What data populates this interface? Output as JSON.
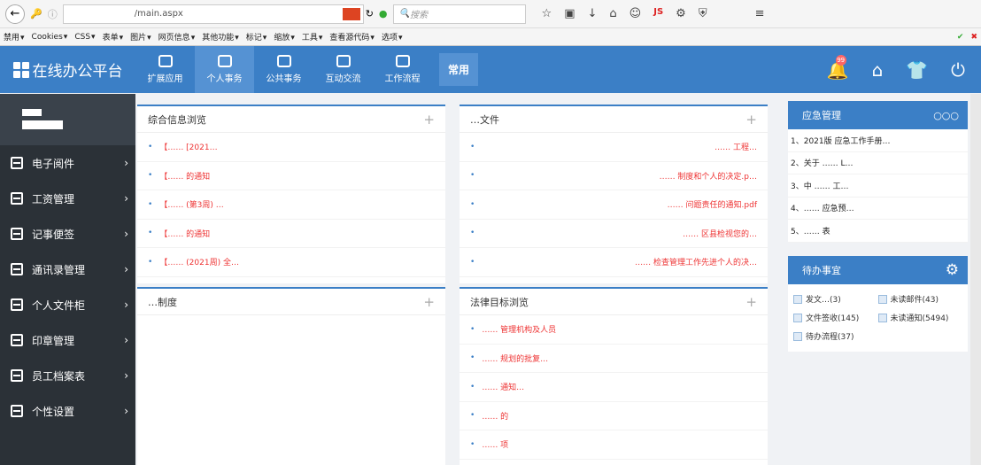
{
  "browser": {
    "url": "/main.aspx",
    "search_placeholder": "搜索",
    "bookmarks": [
      "禁用",
      "Cookies",
      "CSS",
      "表单",
      "图片",
      "网页信息",
      "其他功能",
      "标记",
      "缩放",
      "工具",
      "查看源代码",
      "选项"
    ]
  },
  "header": {
    "logo": "在线办公平台",
    "nav": [
      "扩展应用",
      "个人事务",
      "公共事务",
      "互动交流",
      "工作流程"
    ],
    "common": "常用",
    "notification_count": "99"
  },
  "sidebar": {
    "items": [
      "电子阅件",
      "工资管理",
      "记事便签",
      "通讯录管理",
      "个人文件柜",
      "印章管理",
      "员工档案表",
      "个性设置"
    ]
  },
  "panels": {
    "info": {
      "title": "综合信息浏览",
      "rows": [
        "【…… [2021…",
        "【…… 的通知",
        "【…… (第3周) …",
        "【…… 的通知",
        "【…… (2021周) 全…"
      ]
    },
    "files": {
      "title": "…文件",
      "rows": [
        "…… 工程…",
        "…… 制度和个人的决定.p…",
        "…… 问题责任的通知.pdf",
        "…… 区县检视您的…",
        "…… 检查管理工作先进个人的决…"
      ]
    },
    "rules": {
      "title": "…制度",
      "rows": []
    },
    "law": {
      "title": "法律目标浏览",
      "rows": [
        "…… 管理机构及人员",
        "…… 规划的批复…",
        "…… 通知…",
        "…… 的",
        "…… 项"
      ]
    }
  },
  "emergency": {
    "title": "应急管理",
    "more": "○○○",
    "items": [
      "1、2021版 应急工作手册…",
      "2、关于 …… L…",
      "3、中 …… 工…",
      "4、…… 应急预…",
      "5、…… 表"
    ]
  },
  "todo": {
    "title": "待办事宜",
    "items": [
      "发文…(3)",
      "未读邮件(43)",
      "文件签收(145)",
      "未读通知(5494)",
      "待办流程(37)"
    ]
  }
}
